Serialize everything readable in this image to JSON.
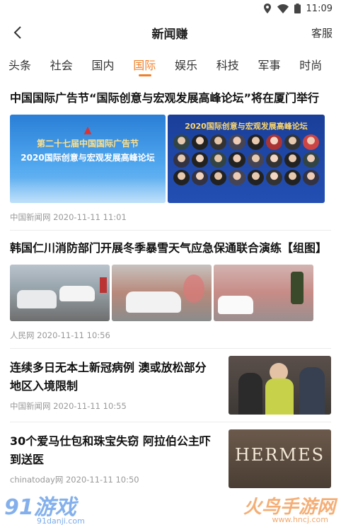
{
  "status": {
    "time": "11:09"
  },
  "header": {
    "title": "新闻赚",
    "right_label": "客服"
  },
  "tabs": [
    {
      "label": "头条"
    },
    {
      "label": "社会"
    },
    {
      "label": "国内"
    },
    {
      "label": "国际",
      "active": true
    },
    {
      "label": "娱乐"
    },
    {
      "label": "科技"
    },
    {
      "label": "军事"
    },
    {
      "label": "时尚"
    }
  ],
  "articles": [
    {
      "headline": "中国国际广告节“国际创意与宏观发展高峰论坛”将在厦门举行",
      "meta": "中国新闻网 2020-11-11 11:01",
      "images": [
        {
          "caption_1": "第二十七届中国国际广告节",
          "caption_2": "2020国际创意与宏观发展高峰论坛"
        },
        {
          "caption_1": "2020国际创意与宏观发展高峰论坛"
        }
      ]
    },
    {
      "headline": "韩国仁川消防部门开展冬季暴雪天气应急保通联合演练【组图】",
      "meta": "人民网 2020-11-11 10:56"
    },
    {
      "headline": "连续多日无本土新冠病例 澳或放松部分地区入境限制",
      "meta": "中国新闻网 2020-11-11 10:55"
    },
    {
      "headline": "30个爱马仕包和珠宝失窃 阿拉伯公主吓到送医",
      "meta": "chinatoday网 2020-11-11 10:50",
      "thumb_text": "HERMES"
    }
  ],
  "watermarks": {
    "left": "91游戏",
    "left_sub": "91danji.com",
    "right": "火鸟手游网",
    "right_sub": "www.hncj.com"
  },
  "colors": {
    "accent": "#f0802a"
  }
}
